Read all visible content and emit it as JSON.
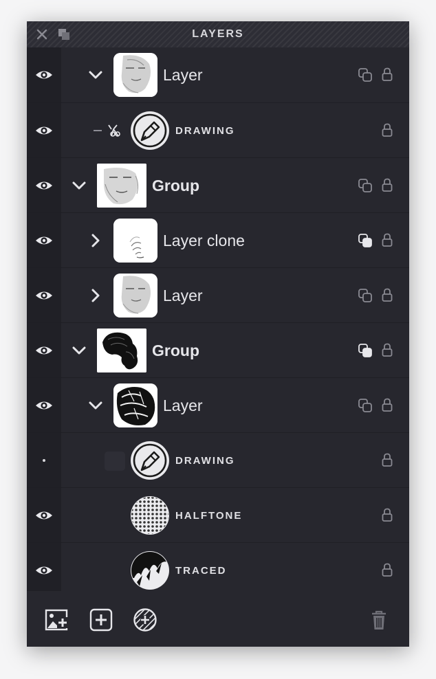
{
  "panel": {
    "title": "LAYERS",
    "close_icon": "close-icon",
    "float_icon": "float-window-icon"
  },
  "layers": [
    {
      "name": "Layer",
      "kind": "layer",
      "visible": true,
      "expanded": true,
      "thumb": "face",
      "blend": "stack-outline-icon",
      "locked_icon": "lock-icon"
    },
    {
      "name": "DRAWING",
      "kind": "filter",
      "visible": true,
      "icon": "pencil-circle-icon",
      "link": "clipped-link-icon",
      "locked_icon": "lock-icon"
    },
    {
      "name": "Group",
      "kind": "group",
      "visible": true,
      "expanded": true,
      "thumb": "face-wide",
      "blend": "stack-outline-icon",
      "locked_icon": "lock-icon"
    },
    {
      "name": "Layer clone",
      "kind": "layer",
      "visible": true,
      "expanded": false,
      "thumb": "ear",
      "blend": "stack-filled-icon",
      "locked_icon": "lock-icon"
    },
    {
      "name": "Layer",
      "kind": "layer",
      "visible": true,
      "expanded": false,
      "thumb": "face",
      "blend": "stack-outline-icon",
      "locked_icon": "lock-icon"
    },
    {
      "name": "Group",
      "kind": "group",
      "visible": true,
      "expanded": true,
      "thumb": "hair",
      "blend": "stack-filled-icon",
      "locked_icon": "lock-icon"
    },
    {
      "name": "Layer",
      "kind": "layer",
      "visible": true,
      "expanded": true,
      "thumb": "traced-hair",
      "blend": "stack-outline-icon",
      "locked_icon": "lock-icon"
    },
    {
      "name": "DRAWING",
      "kind": "filter",
      "visible": false,
      "icon": "pencil-circle-icon",
      "locked_icon": "lock-icon"
    },
    {
      "name": "HALFTONE",
      "kind": "filter",
      "visible": true,
      "icon": "halftone-circle-icon",
      "locked_icon": "lock-icon"
    },
    {
      "name": "TRACED",
      "kind": "filter",
      "visible": true,
      "icon": "traced-circle-icon",
      "locked_icon": "lock-icon"
    }
  ],
  "footer": {
    "add_image_icon": "add-image-layer-icon",
    "add_layer_icon": "add-layer-icon",
    "add_filter_icon": "add-filter-icon",
    "delete_icon": "trash-icon"
  }
}
